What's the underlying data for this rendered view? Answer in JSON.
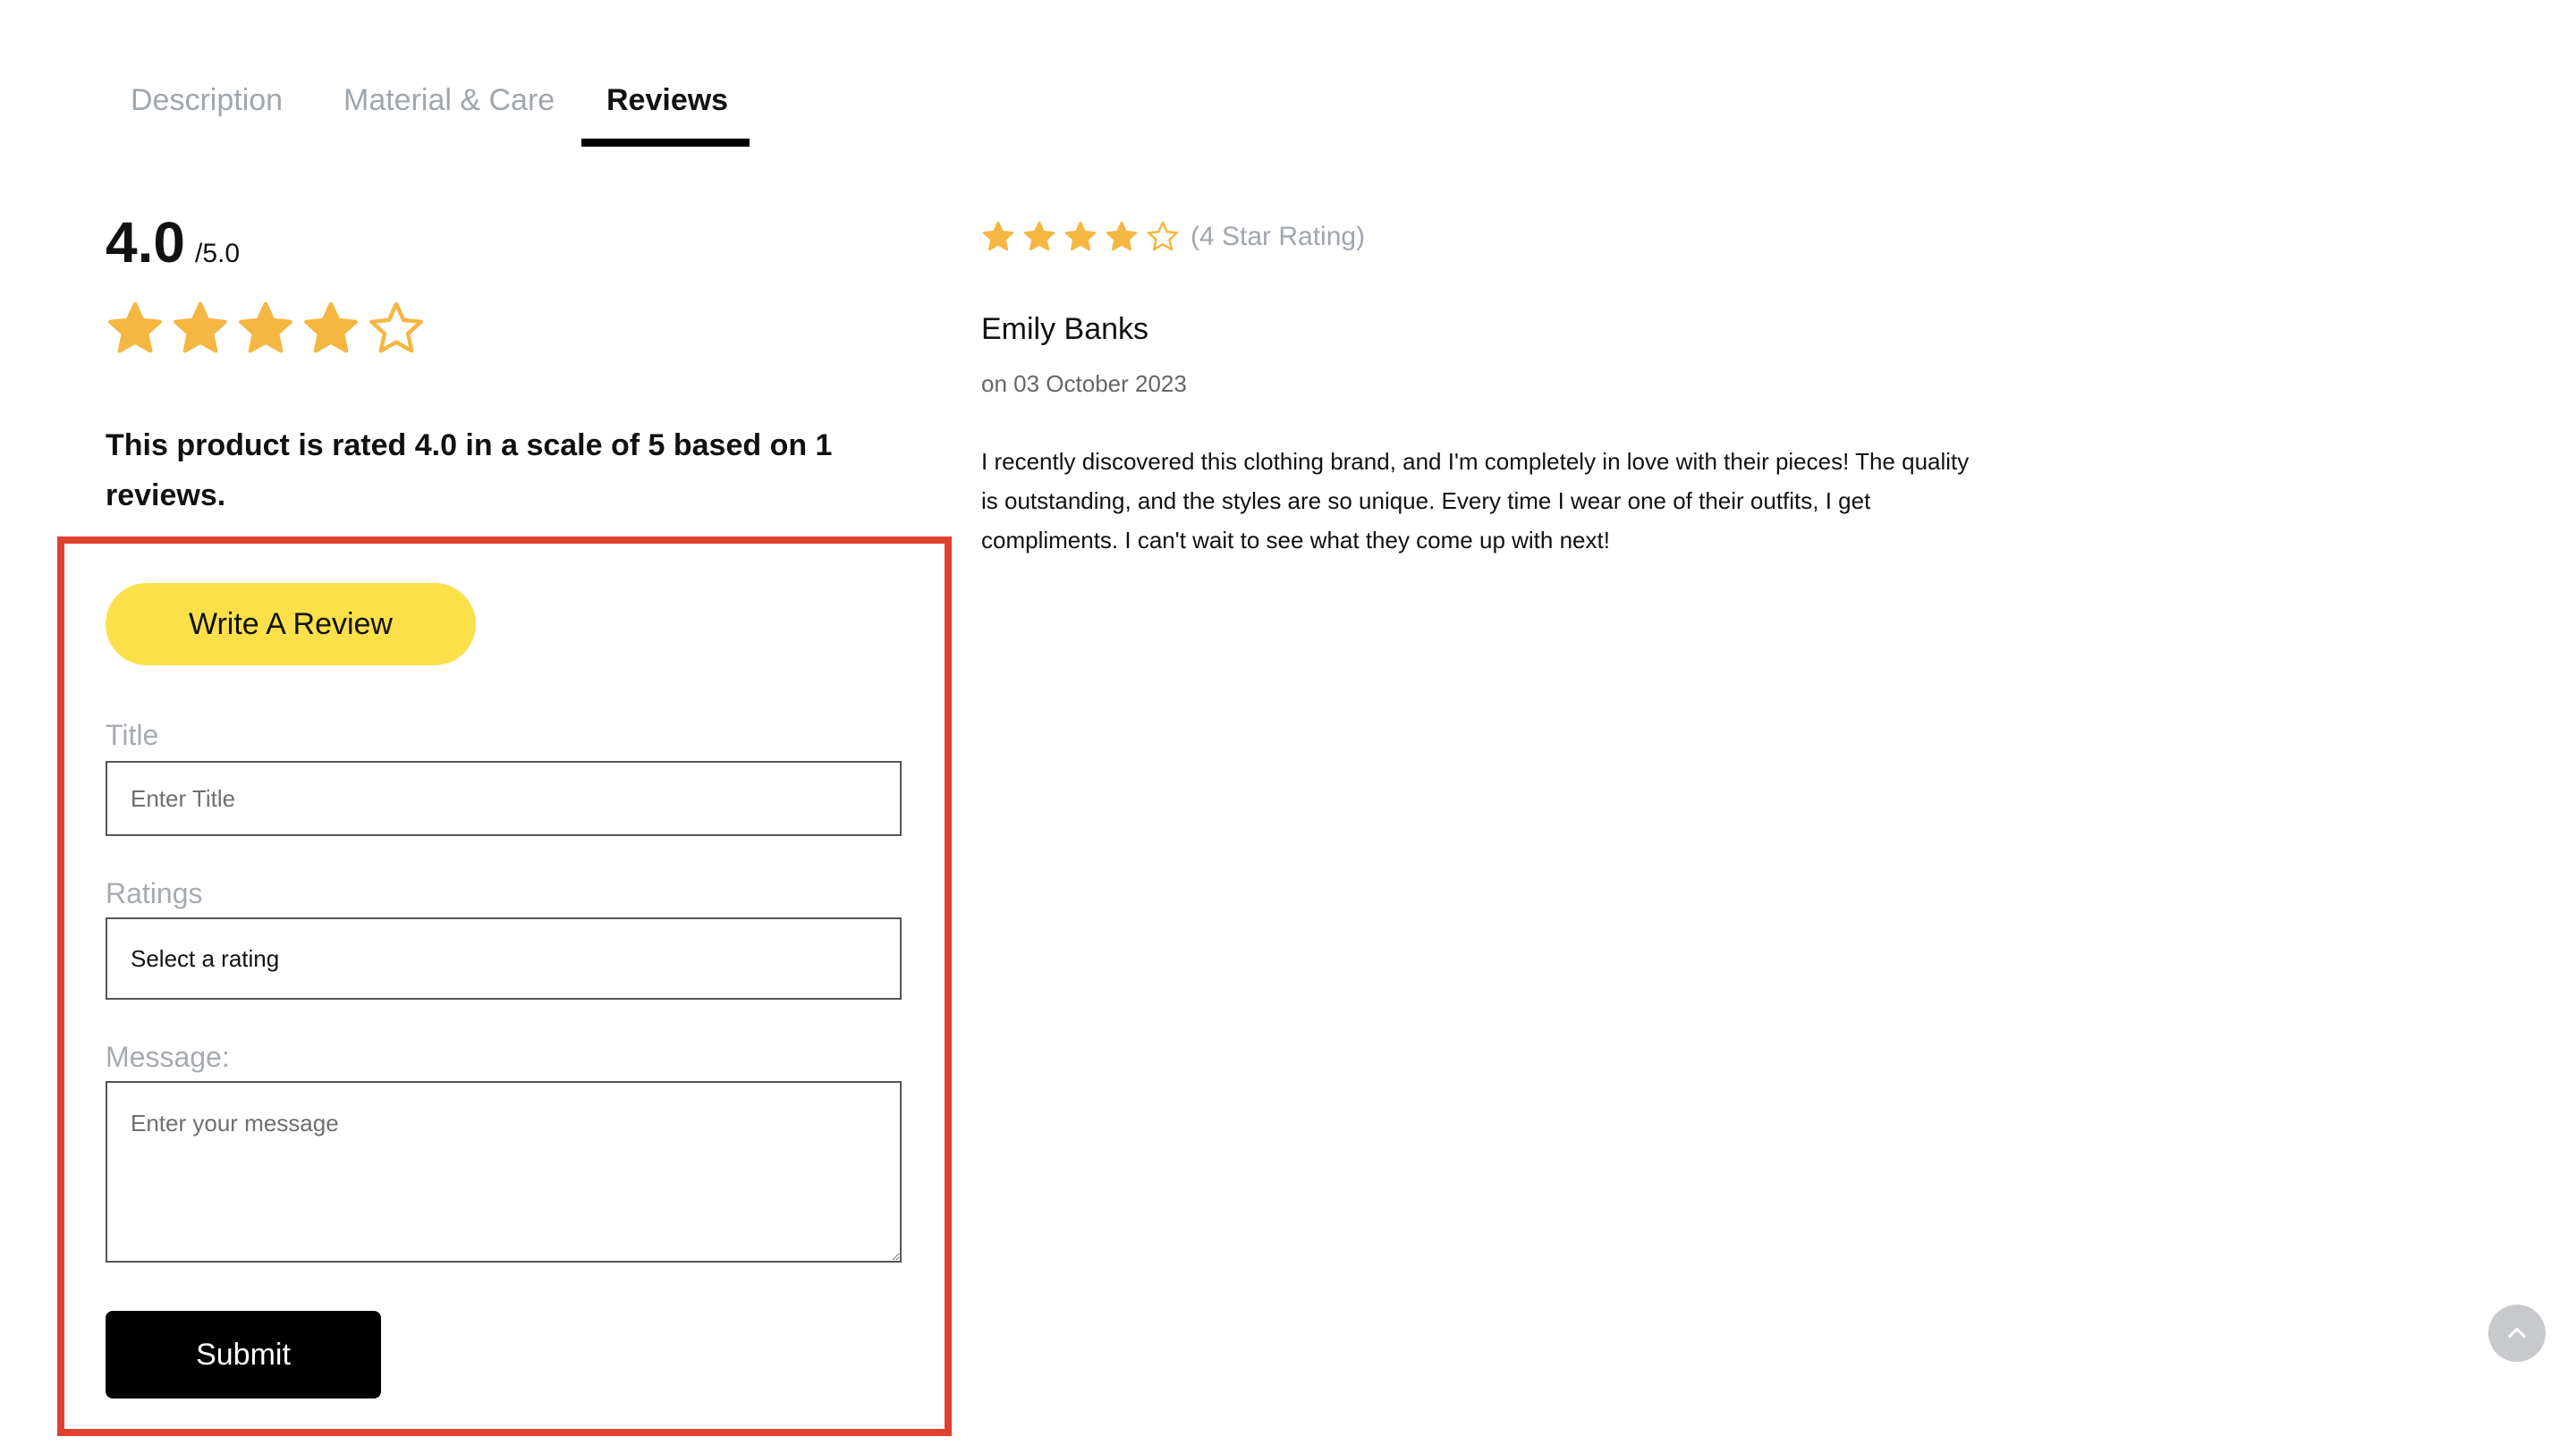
{
  "tabs": [
    {
      "label": "Description",
      "active": false
    },
    {
      "label": "Material & Care",
      "active": false
    },
    {
      "label": "Reviews",
      "active": true
    }
  ],
  "summary": {
    "rating": "4.0",
    "max": "/5.0",
    "stars_filled": 4,
    "stars_total": 5,
    "text": "This product is rated 4.0 in a scale of 5 based on 1 reviews."
  },
  "form": {
    "write_review_label": "Write A Review",
    "title_label": "Title",
    "title_placeholder": "Enter Title",
    "ratings_label": "Ratings",
    "ratings_selected": "Select a rating",
    "message_label": "Message:",
    "message_placeholder": "Enter your message",
    "submit_label": "Submit"
  },
  "review": {
    "stars_filled": 4,
    "stars_total": 5,
    "rating_text": "(4 Star Rating)",
    "author": "Emily Banks",
    "date": "on 03 October 2023",
    "body": "I recently discovered this clothing brand, and I'm completely in love with their pieces! The quality is outstanding, and the styles are so unique. Every time I wear one of their outfits, I get compliments. I can't wait to see what they come up with next!"
  },
  "colors": {
    "star": "#f5b642",
    "accent_button": "#fbe04a",
    "highlight": "#e0412e"
  },
  "icons": {
    "star_filled": "star-filled-icon",
    "star_empty": "star-outline-icon",
    "scroll_top": "chevron-up-icon"
  }
}
